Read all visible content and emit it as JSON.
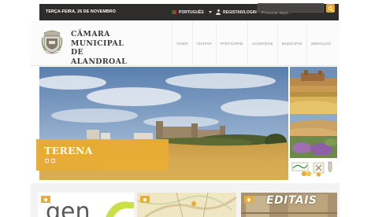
{
  "topbar": {
    "date": "TERÇA-FEIRA, 26 DE NOVEMBRO",
    "language": "PORTUGUÊS",
    "login": "REGISTAR/LOGIN",
    "search_placeholder": "Procurar aqui..."
  },
  "header": {
    "brand_lines": [
      "CÂMARA",
      "MUNICIPAL",
      "DE",
      "ALANDROAL"
    ],
    "nav": [
      "VIVER",
      "VISITAR",
      "PARTICIPAR",
      "ACONTECE",
      "MUNICÍPIO",
      "SERVIÇOS"
    ]
  },
  "hero": {
    "title": "TERENA"
  },
  "cards": {
    "editais": "EDITAIS"
  },
  "colors": {
    "accent": "#e7ad34",
    "topbar": "#2f2d2c",
    "brand_text": "#3b3b3b"
  },
  "icons": [
    "flag-icon",
    "user-icon",
    "search-icon",
    "crest-icon",
    "location-pin-icon"
  ]
}
